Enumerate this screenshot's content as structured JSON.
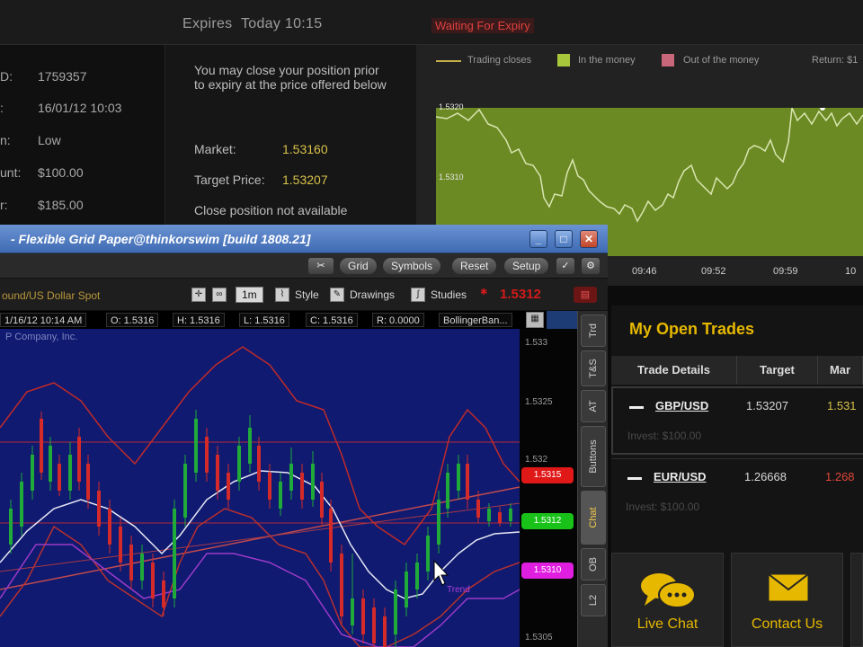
{
  "top_bar": {
    "expires_label": "Expires",
    "expires_value": "Today 10:15",
    "status": "Waiting For Expiry"
  },
  "trade_info": [
    {
      "label": "D:",
      "value": "1759357"
    },
    {
      "label": ":",
      "value": "16/01/12 10:03"
    },
    {
      "label": "n:",
      "value": "Low"
    },
    {
      "label": "unt:",
      "value": "$100.00"
    },
    {
      "label": "r:",
      "value": "$185.00"
    }
  ],
  "close_panel": {
    "note": "You may close your position prior to expiry at the price offered below",
    "market_label": "Market:",
    "market_value": "1.53160",
    "target_label": "Target Price:",
    "target_value": "1.53207",
    "not_available": "Close position not available"
  },
  "expiry_chart": {
    "legend": {
      "closes": "Trading closes",
      "in_money": "In the money",
      "out_money": "Out of the money",
      "return": "Return: $1"
    },
    "y_labels": [
      "1.5320",
      "1.5310"
    ],
    "x_labels": [
      "09:46",
      "09:52",
      "09:59",
      "10"
    ],
    "colors": {
      "in_money": "#a8c73a",
      "out_money": "#c8667a",
      "closes": "#c7b04a",
      "plot": "#6c8a24"
    }
  },
  "open_trades": {
    "title": "My Open Trades",
    "columns": [
      "Trade Details",
      "Target",
      "Mar"
    ],
    "rows": [
      {
        "pair": "GBP/USD",
        "target": "1.53207",
        "market": "1.531",
        "invest": "Invest: $100.00"
      },
      {
        "pair": "EUR/USD",
        "target": "1.26668",
        "market": "1.268",
        "invest": "Invest: $100.00"
      }
    ]
  },
  "support": {
    "live_chat": "Live Chat",
    "contact": "Contact Us"
  },
  "tos": {
    "title": "- Flexible Grid Paper@thinkorswim [build 1808.21]",
    "toolbar": {
      "grid": "Grid",
      "symbols": "Symbols",
      "reset": "Reset",
      "setup": "Setup"
    },
    "chart_bar": {
      "symbol": "ound/US Dollar Spot",
      "interval": "1m",
      "style": "Style",
      "drawings": "Drawings",
      "studies": "Studies",
      "last": "1.5312"
    },
    "quotes": [
      "1/16/12 10:14 AM",
      "O: 1.5316",
      "H: 1.5316",
      "L: 1.5316",
      "C: 1.5316",
      "R: 0.0000",
      "BollingerBan..."
    ],
    "company": "P Company, Inc.",
    "axis_labels": [
      "1.533",
      "1.5325",
      "1.532",
      "1.5305"
    ],
    "price_tags": [
      {
        "value": "1.5315",
        "color": "#e01818"
      },
      {
        "value": "1.5312",
        "color": "#19c219"
      },
      {
        "value": "1.5310",
        "color": "#e01ee0"
      }
    ],
    "drawing_label": "Trend",
    "side_tabs": [
      "Trd",
      "T&S",
      "AT",
      "Buttons",
      "Chat",
      "OB",
      "L2"
    ]
  }
}
